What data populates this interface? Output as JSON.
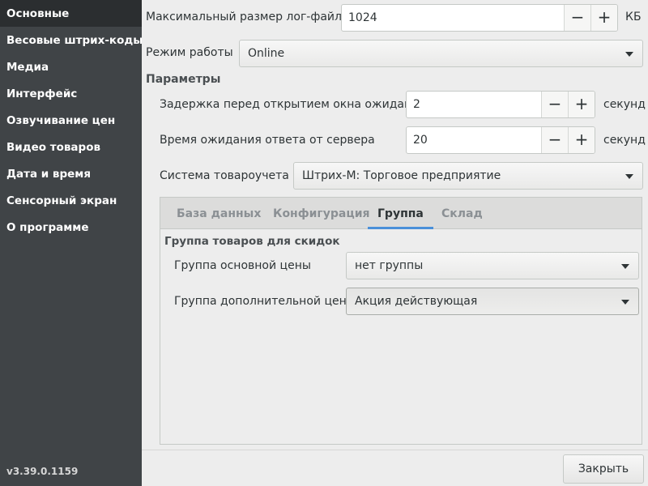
{
  "sidebar": {
    "items": [
      {
        "label": "Основные"
      },
      {
        "label": "Весовые штрих-коды"
      },
      {
        "label": "Медиа"
      },
      {
        "label": "Интерфейс"
      },
      {
        "label": "Озвучивание цен"
      },
      {
        "label": "Видео товаров"
      },
      {
        "label": "Дата и время"
      },
      {
        "label": "Сенсорный экран"
      },
      {
        "label": "О программе"
      }
    ],
    "active_index": 0,
    "version": "v3.39.0.1159"
  },
  "settings": {
    "log_size": {
      "label": "Максимальный размер лог-файла",
      "value": "1024",
      "unit": "КБ"
    },
    "mode": {
      "label": "Режим работы",
      "value": "Online"
    },
    "params_header": "Параметры",
    "wait_delay": {
      "label": "Задержка перед открытием окна ожидания",
      "value": "2",
      "unit": "секунд"
    },
    "server_timeout": {
      "label": "Время ожидания ответа от сервера",
      "value": "20",
      "unit": "секунд"
    },
    "accounting": {
      "label": "Система товароучета",
      "value": "Штрих-М: Торговое предприятие"
    }
  },
  "controls": {
    "minus": "−",
    "plus": "+"
  },
  "tabs": {
    "items": [
      {
        "label": "База данных"
      },
      {
        "label": "Конфигурация"
      },
      {
        "label": "Группа"
      },
      {
        "label": "Склад"
      }
    ],
    "active_index": 2
  },
  "group_tab": {
    "header": "Группа товаров для скидок",
    "main_price": {
      "label": "Группа основной цены",
      "value": "нет группы"
    },
    "extra_price": {
      "label": "Группа дополнительной цены",
      "value": "Акция действующая"
    }
  },
  "footer": {
    "close_label": "Закрыть"
  },
  "colors": {
    "sidebar_bg": "#404447",
    "sidebar_active": "#2b2e30",
    "accent": "#4a90d9",
    "window_bg": "#ededed"
  }
}
